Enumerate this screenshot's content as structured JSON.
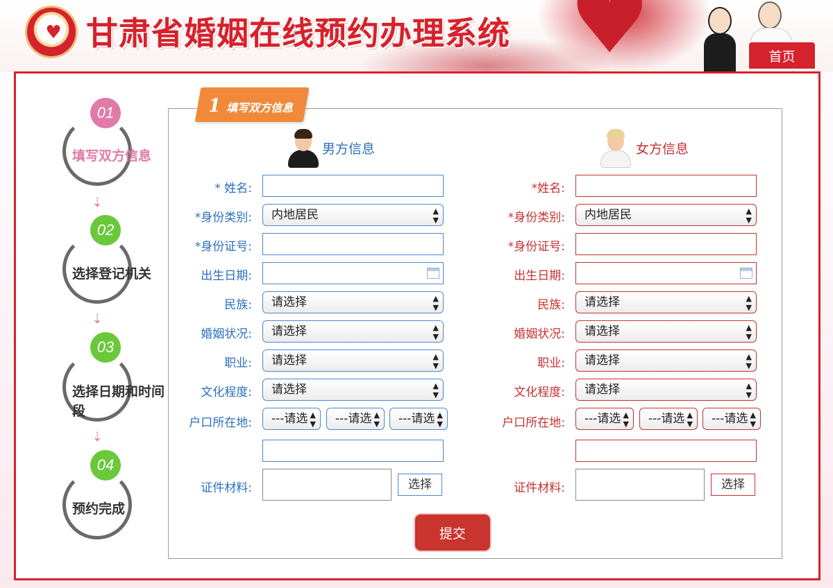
{
  "header": {
    "site_title": "甘肃省婚姻在线预约办理系统",
    "home_label": "首页"
  },
  "steps": [
    {
      "num": "01",
      "label": "填写双方信息",
      "color": "#e07aa6",
      "active": true
    },
    {
      "num": "02",
      "label": "选择登记机关",
      "color": "#6ac83a",
      "active": false
    },
    {
      "num": "03",
      "label": "选择日期和时间段",
      "label_line1": "选择日期和时间",
      "label_line2": "段",
      "color": "#6ac83a",
      "active": false
    },
    {
      "num": "04",
      "label": "预约完成",
      "color": "#6ac83a",
      "active": false
    }
  ],
  "section": {
    "num": "1",
    "title": "填写双方信息"
  },
  "male": {
    "title": "男方信息",
    "name_label": "* 姓名:",
    "idtype_label": "*身份类别:",
    "idtype_value": "内地居民",
    "idno_label": "*身份证号:",
    "birth_label": "出生日期:",
    "ethnic_label": "民族:",
    "ethnic_value": "请选择",
    "marital_label": "婚姻状况:",
    "marital_value": "请选择",
    "job_label": "职业:",
    "job_value": "请选择",
    "edu_label": "文化程度:",
    "edu_value": "请选择",
    "hukou_label": "户口所在地:",
    "hukou_values": [
      "---请选",
      "---请选",
      "---请选"
    ],
    "docs_label": "证件材料:",
    "choose_label": "选择"
  },
  "female": {
    "title": "女方信息",
    "name_label": "*姓名:",
    "idtype_label": "*身份类别:",
    "idtype_value": "内地居民",
    "idno_label": "*身份证号:",
    "birth_label": "出生日期:",
    "ethnic_label": "民族:",
    "ethnic_value": "请选择",
    "marital_label": "婚姻状况:",
    "marital_value": "请选择",
    "job_label": "职业:",
    "job_value": "请选择",
    "edu_label": "文化程度:",
    "edu_value": "请选择",
    "hukou_label": "户口所在地:",
    "hukou_values": [
      "---请选",
      "---请选",
      "---请选"
    ],
    "docs_label": "证件材料:",
    "choose_label": "选择"
  },
  "submit_label": "提交",
  "colors": {
    "brand_red": "#d6222c",
    "male_blue": "#2b6fbf",
    "female_red": "#c3322f",
    "step_pink": "#e07aa6",
    "step_green": "#6ac83a"
  }
}
